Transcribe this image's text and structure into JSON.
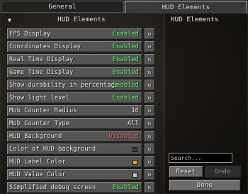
{
  "tabs": [
    {
      "label": "General"
    },
    {
      "label": "HUD Elements"
    }
  ],
  "section": {
    "arrow": "▼",
    "title": "HUD Elements"
  },
  "colors": {
    "enabled": "#55ff55",
    "disabled": "#ff5555",
    "hud_label_color_swatch": "#ffa500",
    "hud_background_swatch": "#3c3c3c",
    "hud_value_color_swatch": "#c8c8c8"
  },
  "rows": [
    {
      "label": "FPS Display",
      "value": "Enabled",
      "status": "green"
    },
    {
      "label": "Coordinates Display",
      "value": "Enabled",
      "status": "green"
    },
    {
      "label": "Real Time Display",
      "value": "Enabled",
      "status": "green"
    },
    {
      "label": "Game Time Display",
      "value": "Enabled",
      "status": "green"
    },
    {
      "label": "Show durability in percentage",
      "value": "Enabled",
      "status": "green"
    },
    {
      "label": "Show light level",
      "value": "Enabled",
      "status": "green"
    },
    {
      "label": "Mob Counter Radius",
      "value": "16",
      "status": "white"
    },
    {
      "label": "Mob Counter Type",
      "value": "All",
      "status": "white"
    },
    {
      "label": "HUD Background",
      "value": "Disabled",
      "status": "red"
    },
    {
      "label": "Color of HUD background",
      "value": "",
      "status": "swatch"
    },
    {
      "label": "HUD Label Color",
      "value": "",
      "status": "swatch"
    },
    {
      "label": "HUD Value Color",
      "value": "",
      "status": "swatch"
    },
    {
      "label": "Simplified debug screen",
      "value": "Enabled",
      "status": "green"
    }
  ],
  "reset_icon": "↻",
  "details": {
    "title": "HUD Elements"
  },
  "search": {
    "placeholder": "Search...",
    "value": ""
  },
  "buttons": {
    "reset": "Reset",
    "undo": "Undo",
    "done": "Done"
  }
}
